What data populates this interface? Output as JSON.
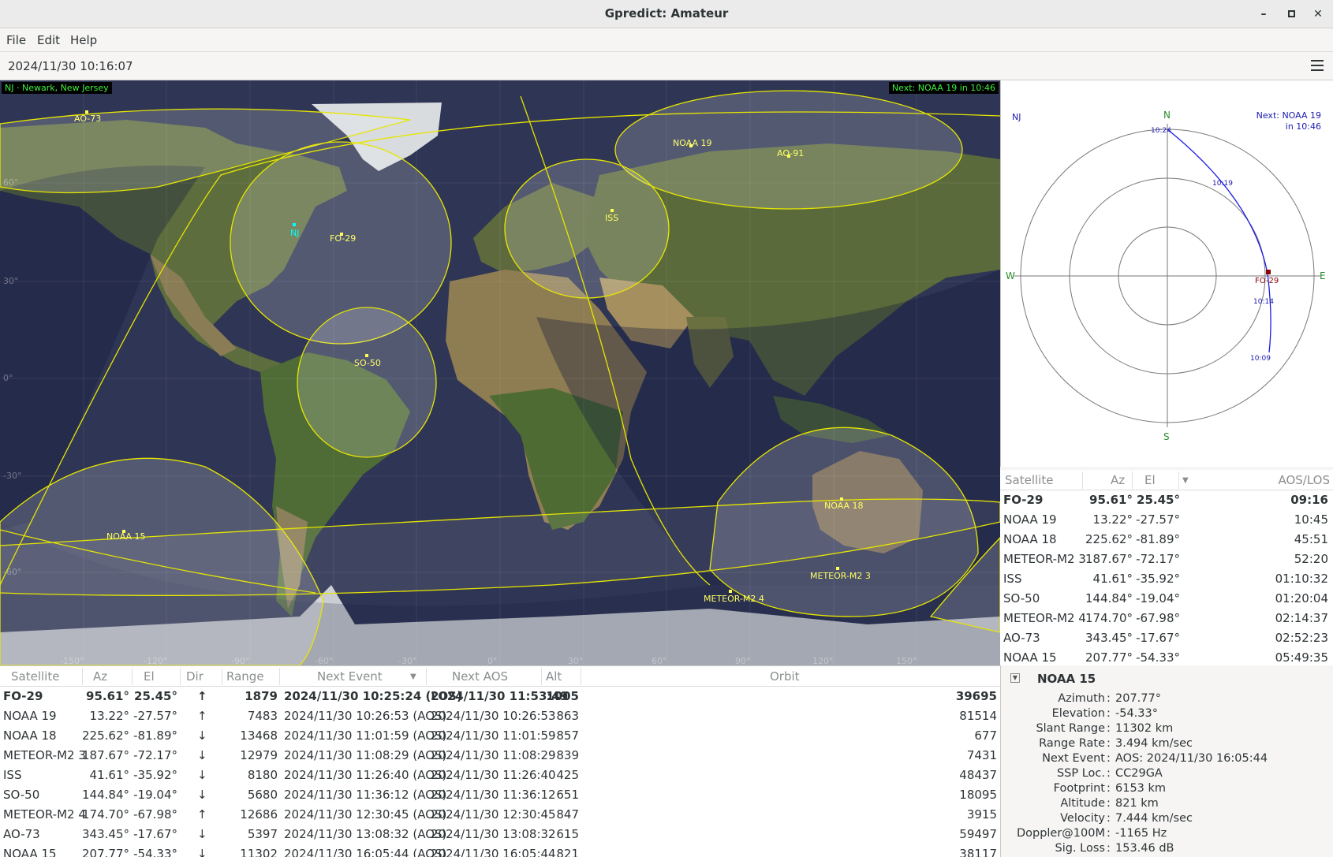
{
  "window": {
    "title": "Gpredict: Amateur"
  },
  "menu": [
    "File",
    "Edit",
    "Help"
  ],
  "time": "2024/11/30 10:16:07",
  "map": {
    "qth_label": "NJ · Newark, New Jersey",
    "next_label": "Next: NOAA 19 in 10:46",
    "qth_marker": "NJ",
    "lat_labels": [
      "60°",
      "30°",
      "0°",
      "-30°",
      "-60°"
    ],
    "lon_labels": [
      "-150°",
      "-120°",
      "-90°",
      "-60°",
      "-30°",
      "0°",
      "30°",
      "60°",
      "90°",
      "120°",
      "150°"
    ],
    "satellites": [
      "AO-73",
      "NOAA 19",
      "AO-91",
      "FO-29",
      "ISS",
      "SO-50",
      "NOAA 15",
      "NOAA 18",
      "METEOR-M2 3",
      "METEOR-M2 4"
    ]
  },
  "polar": {
    "qth": "NJ",
    "next_line1": "Next: NOAA 19",
    "next_line2": "in 10:46",
    "n": "N",
    "s": "S",
    "e": "E",
    "w": "W",
    "sat": "FO-29",
    "times": [
      "10:24",
      "10:19",
      "10:14",
      "10:09"
    ]
  },
  "sat_list": {
    "headers": {
      "sat": "Satellite",
      "az": "Az",
      "el": "El",
      "aos": "AOS/LOS"
    },
    "rows": [
      {
        "sat": "FO-29",
        "az": "95.61°",
        "el": "25.45°",
        "aos": "09:16",
        "bold": true
      },
      {
        "sat": "NOAA 19",
        "az": "13.22°",
        "el": "-27.57°",
        "aos": "10:45"
      },
      {
        "sat": "NOAA 18",
        "az": "225.62°",
        "el": "-81.89°",
        "aos": "45:51"
      },
      {
        "sat": "METEOR-M2 3",
        "az": "187.67°",
        "el": "-72.17°",
        "aos": "52:20"
      },
      {
        "sat": "ISS",
        "az": "41.61°",
        "el": "-35.92°",
        "aos": "01:10:32"
      },
      {
        "sat": "SO-50",
        "az": "144.84°",
        "el": "-19.04°",
        "aos": "01:20:04"
      },
      {
        "sat": "METEOR-M2 4",
        "az": "174.70°",
        "el": "-67.98°",
        "aos": "02:14:37"
      },
      {
        "sat": "AO-73",
        "az": "343.45°",
        "el": "-17.67°",
        "aos": "02:52:23"
      },
      {
        "sat": "NOAA 15",
        "az": "207.77°",
        "el": "-54.33°",
        "aos": "05:49:35"
      }
    ]
  },
  "main_table": {
    "headers": {
      "sat": "Satellite",
      "az": "Az",
      "el": "El",
      "dir": "Dir",
      "range": "Range",
      "next_event": "Next Event",
      "next_aos": "Next AOS",
      "alt": "Alt",
      "orbit": "Orbit"
    },
    "rows": [
      {
        "sat": "FO-29",
        "az": "95.61°",
        "el": "25.45°",
        "dir": "↑",
        "range": "1879",
        "next_event": "2024/11/30 10:25:24 (LOS)",
        "next_aos": "2024/11/30 11:53:49",
        "alt": "1005",
        "orbit": "39695",
        "bold": true
      },
      {
        "sat": "NOAA 19",
        "az": "13.22°",
        "el": "-27.57°",
        "dir": "↑",
        "range": "7483",
        "next_event": "2024/11/30 10:26:53 (AOS)",
        "next_aos": "2024/11/30 10:26:53",
        "alt": "863",
        "orbit": "81514"
      },
      {
        "sat": "NOAA 18",
        "az": "225.62°",
        "el": "-81.89°",
        "dir": "↓",
        "range": "13468",
        "next_event": "2024/11/30 11:01:59 (AOS)",
        "next_aos": "2024/11/30 11:01:59",
        "alt": "857",
        "orbit": "677"
      },
      {
        "sat": "METEOR-M2 3",
        "az": "187.67°",
        "el": "-72.17°",
        "dir": "↓",
        "range": "12979",
        "next_event": "2024/11/30 11:08:29 (AOS)",
        "next_aos": "2024/11/30 11:08:29",
        "alt": "839",
        "orbit": "7431"
      },
      {
        "sat": "ISS",
        "az": "41.61°",
        "el": "-35.92°",
        "dir": "↓",
        "range": "8180",
        "next_event": "2024/11/30 11:26:40 (AOS)",
        "next_aos": "2024/11/30 11:26:40",
        "alt": "425",
        "orbit": "48437"
      },
      {
        "sat": "SO-50",
        "az": "144.84°",
        "el": "-19.04°",
        "dir": "↓",
        "range": "5680",
        "next_event": "2024/11/30 11:36:12 (AOS)",
        "next_aos": "2024/11/30 11:36:12",
        "alt": "651",
        "orbit": "18095"
      },
      {
        "sat": "METEOR-M2 4",
        "az": "174.70°",
        "el": "-67.98°",
        "dir": "↑",
        "range": "12686",
        "next_event": "2024/11/30 12:30:45 (AOS)",
        "next_aos": "2024/11/30 12:30:45",
        "alt": "847",
        "orbit": "3915"
      },
      {
        "sat": "AO-73",
        "az": "343.45°",
        "el": "-17.67°",
        "dir": "↓",
        "range": "5397",
        "next_event": "2024/11/30 13:08:32 (AOS)",
        "next_aos": "2024/11/30 13:08:32",
        "alt": "615",
        "orbit": "59497"
      },
      {
        "sat": "NOAA 15",
        "az": "207.77°",
        "el": "-54.33°",
        "dir": "↓",
        "range": "11302",
        "next_event": "2024/11/30 16:05:44 (AOS)",
        "next_aos": "2024/11/30 16:05:44",
        "alt": "821",
        "orbit": "38117"
      }
    ]
  },
  "details": {
    "expander": "▼",
    "name": "NOAA 15",
    "rows": [
      {
        "label": "Azimuth",
        "value": "207.77°"
      },
      {
        "label": "Elevation",
        "value": "-54.33°"
      },
      {
        "label": "Slant Range",
        "value": "11302 km"
      },
      {
        "label": "Range Rate",
        "value": "3.494 km/sec"
      },
      {
        "label": "Next Event",
        "value": "AOS: 2024/11/30 16:05:44"
      },
      {
        "label": "SSP Loc.",
        "value": "CC29GA"
      },
      {
        "label": "Footprint",
        "value": "6153 km"
      },
      {
        "label": "Altitude",
        "value": "821 km"
      },
      {
        "label": "Velocity",
        "value": "7.444 km/sec"
      },
      {
        "label": "Doppler@100M",
        "value": "-1165 Hz"
      },
      {
        "label": "Sig. Loss",
        "value": "153.46 dB"
      }
    ]
  }
}
